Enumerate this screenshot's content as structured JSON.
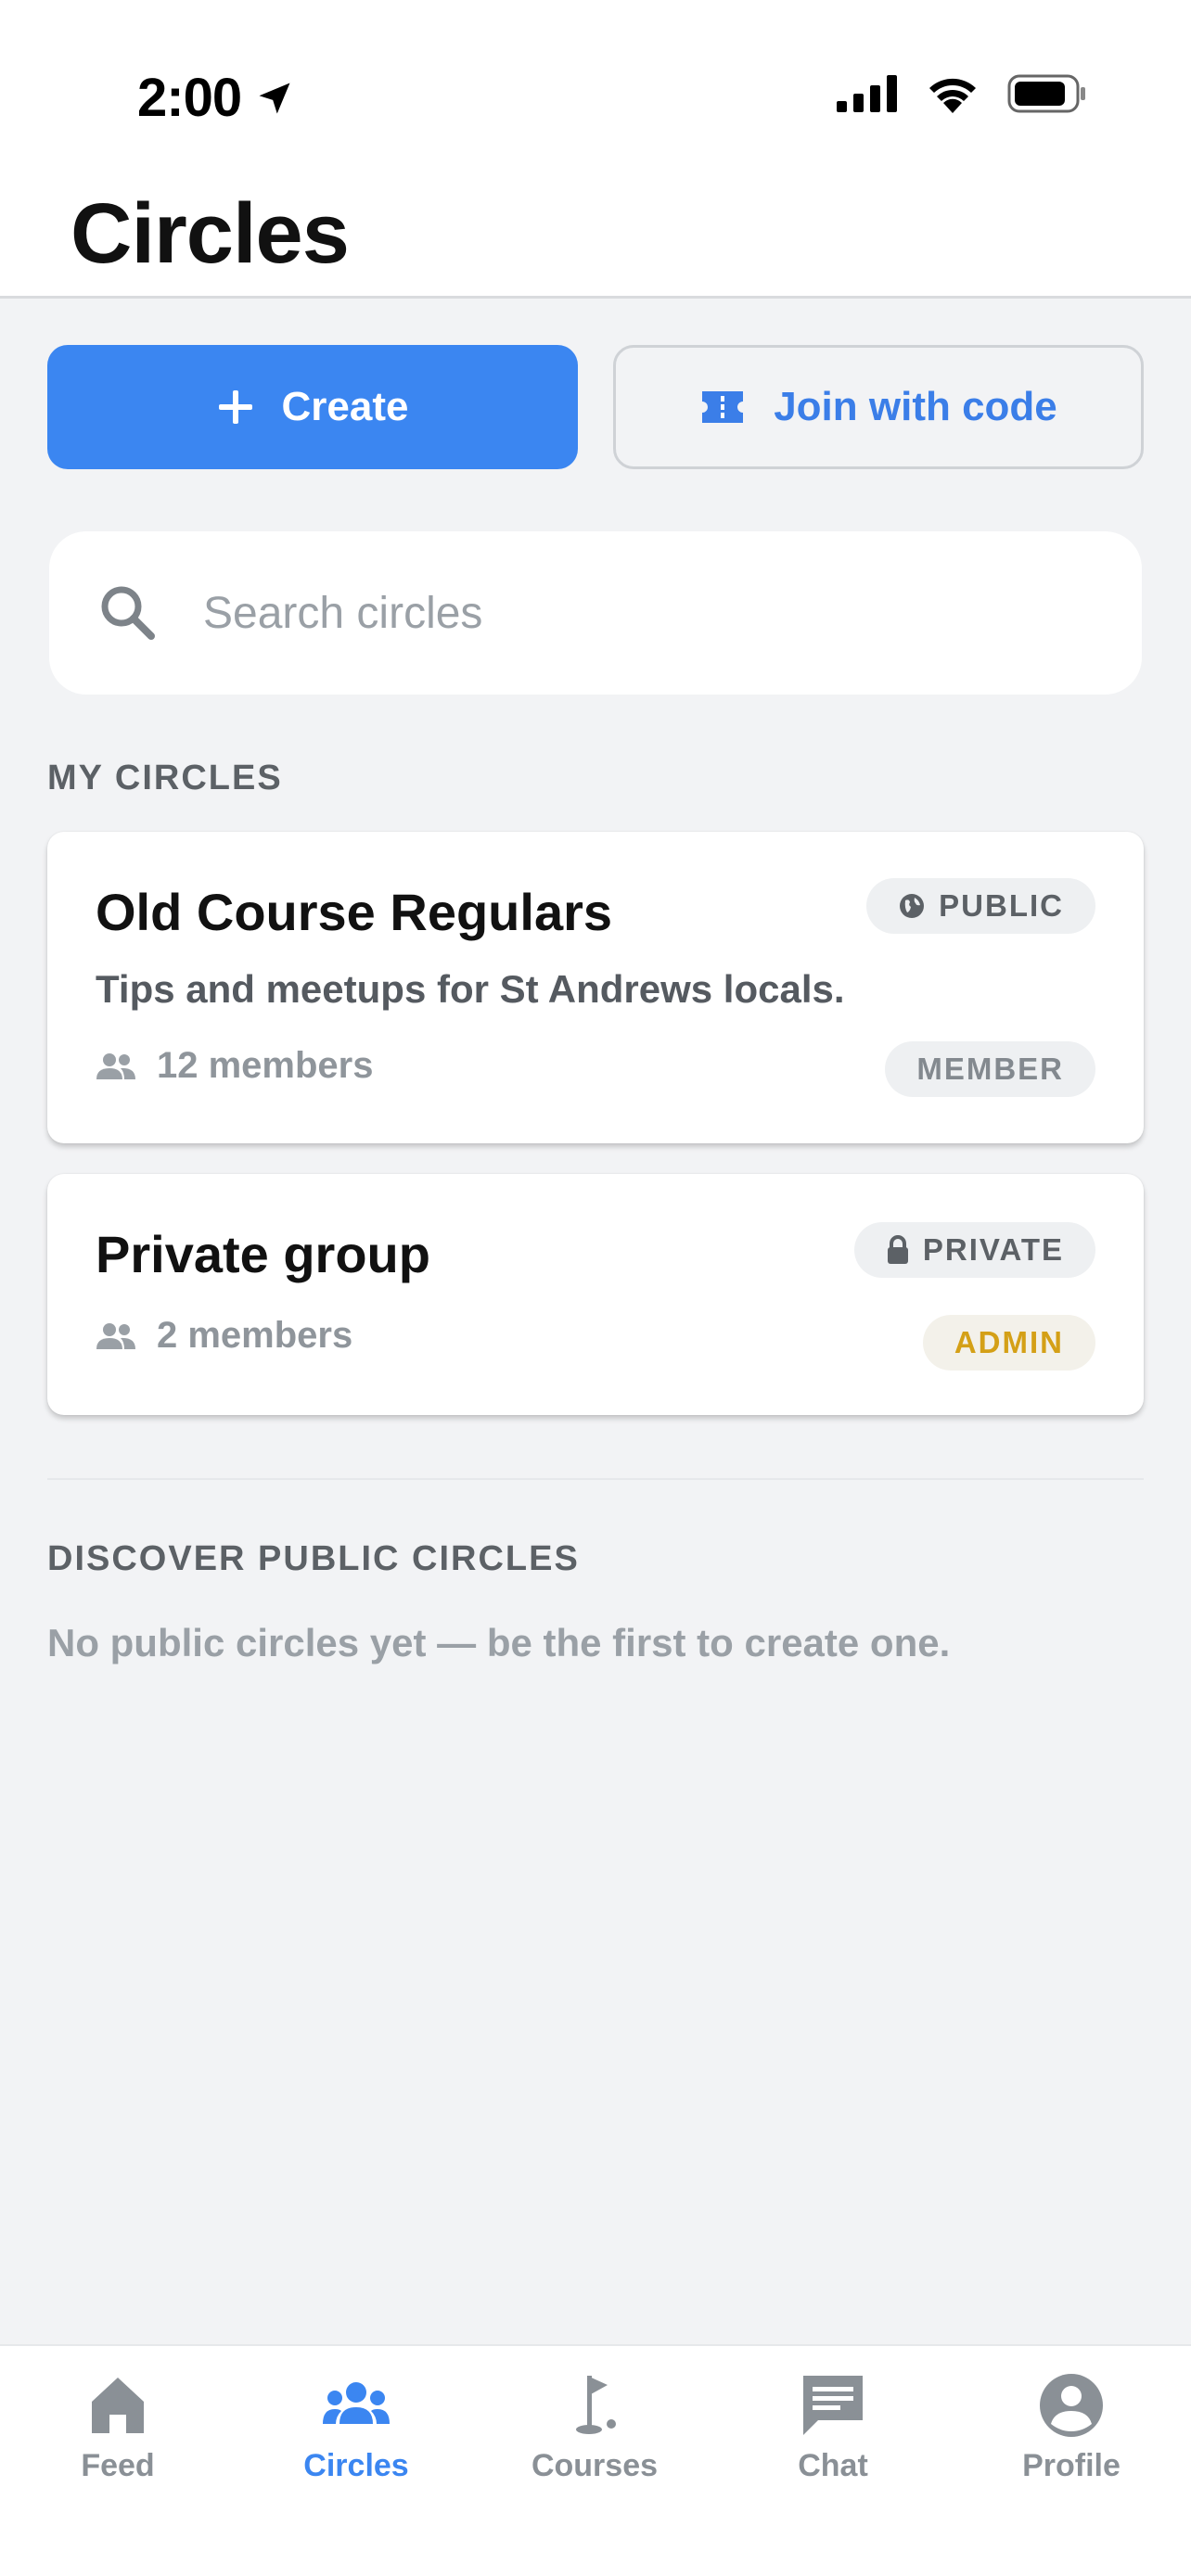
{
  "status_bar": {
    "time": "2:00"
  },
  "header": {
    "title": "Circles"
  },
  "actions": {
    "create_label": "Create",
    "join_label": "Join with code"
  },
  "search": {
    "placeholder": "Search circles",
    "value": ""
  },
  "my_circles": {
    "section_label": "MY CIRCLES",
    "items": [
      {
        "name": "Old Course Regulars",
        "description": "Tips and meetups for St Andrews locals.",
        "members": "12 members",
        "visibility": "PUBLIC",
        "visibility_icon": "globe-icon",
        "role": "MEMBER"
      },
      {
        "name": "Private group",
        "members": "2 members",
        "visibility": "PRIVATE",
        "visibility_icon": "lock-icon",
        "role": "ADMIN"
      }
    ]
  },
  "discover": {
    "section_label": "DISCOVER PUBLIC CIRCLES",
    "empty_text": "No public circles yet — be the first to create one."
  },
  "tabbar": {
    "items": [
      {
        "label": "Feed",
        "icon": "home-icon"
      },
      {
        "label": "Circles",
        "icon": "group-icon",
        "active": true
      },
      {
        "label": "Courses",
        "icon": "golf-flag-icon"
      },
      {
        "label": "Chat",
        "icon": "chat-icon"
      },
      {
        "label": "Profile",
        "icon": "profile-icon"
      }
    ]
  },
  "colors": {
    "accent": "#3b86f1",
    "admin_badge": "#d4a017",
    "background": "#f2f3f5"
  }
}
